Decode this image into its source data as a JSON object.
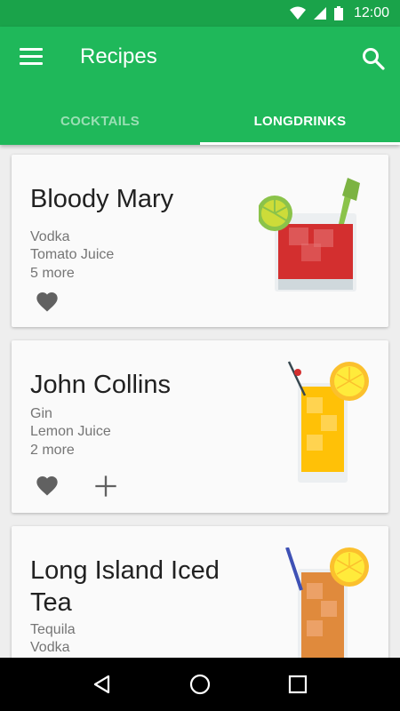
{
  "status_bar": {
    "time": "12:00"
  },
  "app_bar": {
    "title": "Recipes"
  },
  "tabs": [
    {
      "label": "COCKTAILS",
      "active": false
    },
    {
      "label": "LONGDRINKS",
      "active": true
    }
  ],
  "recipes": [
    {
      "name": "Bloody Mary",
      "ingredients": [
        "Vodka",
        "Tomato Juice"
      ],
      "more": "5 more",
      "actions": [
        "heart"
      ]
    },
    {
      "name": "John Collins",
      "ingredients": [
        "Gin",
        "Lemon Juice"
      ],
      "more": "2 more",
      "actions": [
        "heart",
        "plus"
      ]
    },
    {
      "name": "Long Island Iced Tea",
      "ingredients": [
        "Tequila",
        "Vodka"
      ],
      "more": "",
      "actions": []
    }
  ],
  "colors": {
    "primary": "#1FB85A",
    "status_bar": "#1AA34A",
    "background": "#EEEEEE"
  }
}
